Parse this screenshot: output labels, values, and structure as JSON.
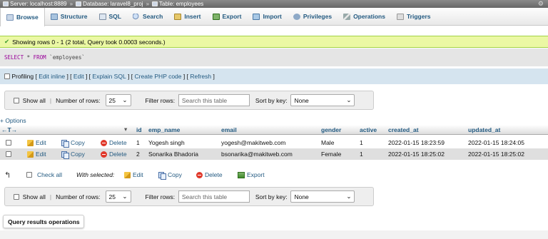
{
  "breadcrumb": {
    "server": "Server: localhost:8889",
    "database": "Database: laravel8_proj",
    "table": "Table: employees",
    "sep": "»"
  },
  "tabs": [
    {
      "label": "Browse",
      "icon": "browse-icon",
      "active": true
    },
    {
      "label": "Structure",
      "icon": "structure-icon"
    },
    {
      "label": "SQL",
      "icon": "sql-icon"
    },
    {
      "label": "Search",
      "icon": "search-icon"
    },
    {
      "label": "Insert",
      "icon": "insert-icon"
    },
    {
      "label": "Export",
      "icon": "export-icon"
    },
    {
      "label": "Import",
      "icon": "import-icon"
    },
    {
      "label": "Privileges",
      "icon": "privileges-icon"
    },
    {
      "label": "Operations",
      "icon": "operations-icon"
    },
    {
      "label": "Triggers",
      "icon": "triggers-icon"
    }
  ],
  "success_message": "Showing rows 0 - 1 (2 total, Query took 0.0003 seconds.)",
  "sql": {
    "select": "SELECT",
    "star": "*",
    "from": "FROM",
    "table": "`employees`"
  },
  "profiling": {
    "label": "Profiling",
    "links": [
      "Edit inline",
      "Edit",
      "Explain SQL",
      "Create PHP code",
      "Refresh"
    ]
  },
  "nav": {
    "show_all": "Show all",
    "number_of_rows_label": "Number of rows:",
    "number_of_rows_value": "25",
    "filter_label": "Filter rows:",
    "filter_placeholder": "Search this table",
    "sort_label": "Sort by key:",
    "sort_value": "None"
  },
  "options_link": "+ Options",
  "table": {
    "columns": [
      "id",
      "emp_name",
      "email",
      "gender",
      "active",
      "created_at",
      "updated_at"
    ],
    "rows": [
      {
        "id": "1",
        "emp_name": "Yogesh singh",
        "email": "yogesh@makitweb.com",
        "gender": "Male",
        "active": "1",
        "created_at": "2022-01-15 18:23:59",
        "updated_at": "2022-01-15 18:24:05"
      },
      {
        "id": "2",
        "emp_name": "Sonarika Bhadoria",
        "email": "bsonarika@makitweb.com",
        "gender": "Female",
        "active": "1",
        "created_at": "2022-01-15 18:25:02",
        "updated_at": "2022-01-15 18:25:02"
      }
    ],
    "row_actions": {
      "edit": "Edit",
      "copy": "Copy",
      "delete": "Delete"
    }
  },
  "with_selected": {
    "check_all": "Check all",
    "label": "With selected:",
    "edit": "Edit",
    "copy": "Copy",
    "delete": "Delete",
    "export": "Export"
  },
  "query_results_operations": "Query results operations",
  "colors": {
    "accent": "#235a81",
    "success_bg": "#ebf8a4",
    "sql_keyword": "#990099",
    "profiling_bg": "#d5e4ef"
  }
}
